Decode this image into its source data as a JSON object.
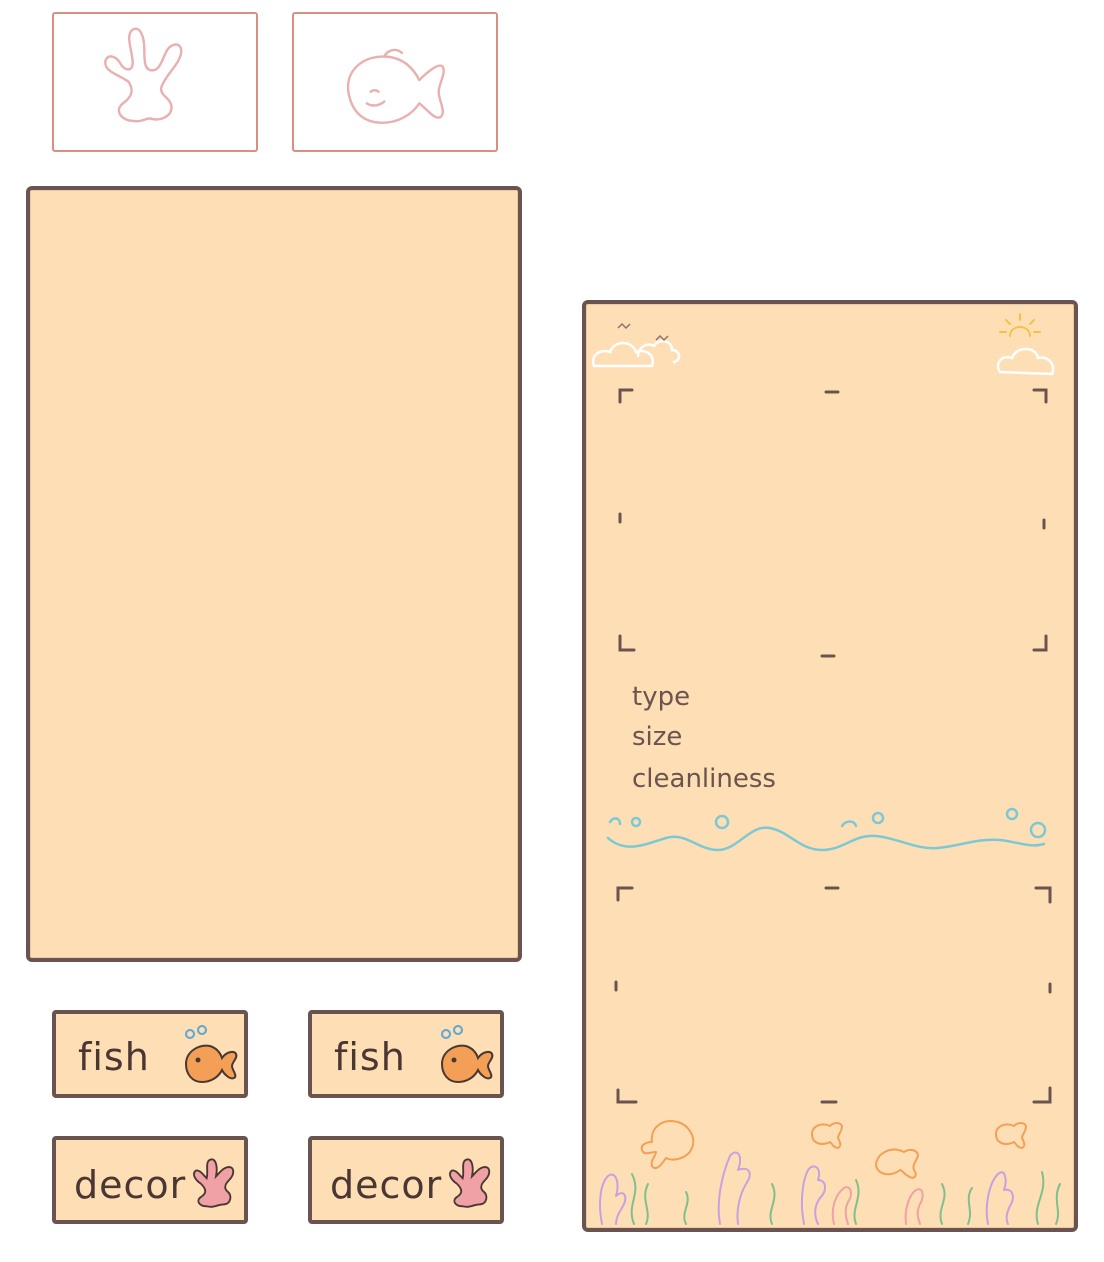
{
  "tabs": [
    {
      "icon": "coral-icon"
    },
    {
      "icon": "fish-icon"
    }
  ],
  "buttons": [
    {
      "label": "fish",
      "icon": "fish-icon"
    },
    {
      "label": "fish",
      "icon": "fish-icon"
    },
    {
      "label": "decor",
      "icon": "coral-icon"
    },
    {
      "label": "decor",
      "icon": "coral-icon"
    }
  ],
  "info_panel": {
    "stats": {
      "type_label": "type",
      "size_label": "size",
      "cleanliness_label": "cleanliness"
    }
  },
  "colors": {
    "panel_fill": "#fedfb5",
    "panel_border": "#6b5450",
    "tab_border": "#d98f84",
    "text": "#4a3632",
    "water": "#7cc8d4",
    "fish_orange": "#f3a056",
    "coral_pink": "#f0a1a6"
  }
}
